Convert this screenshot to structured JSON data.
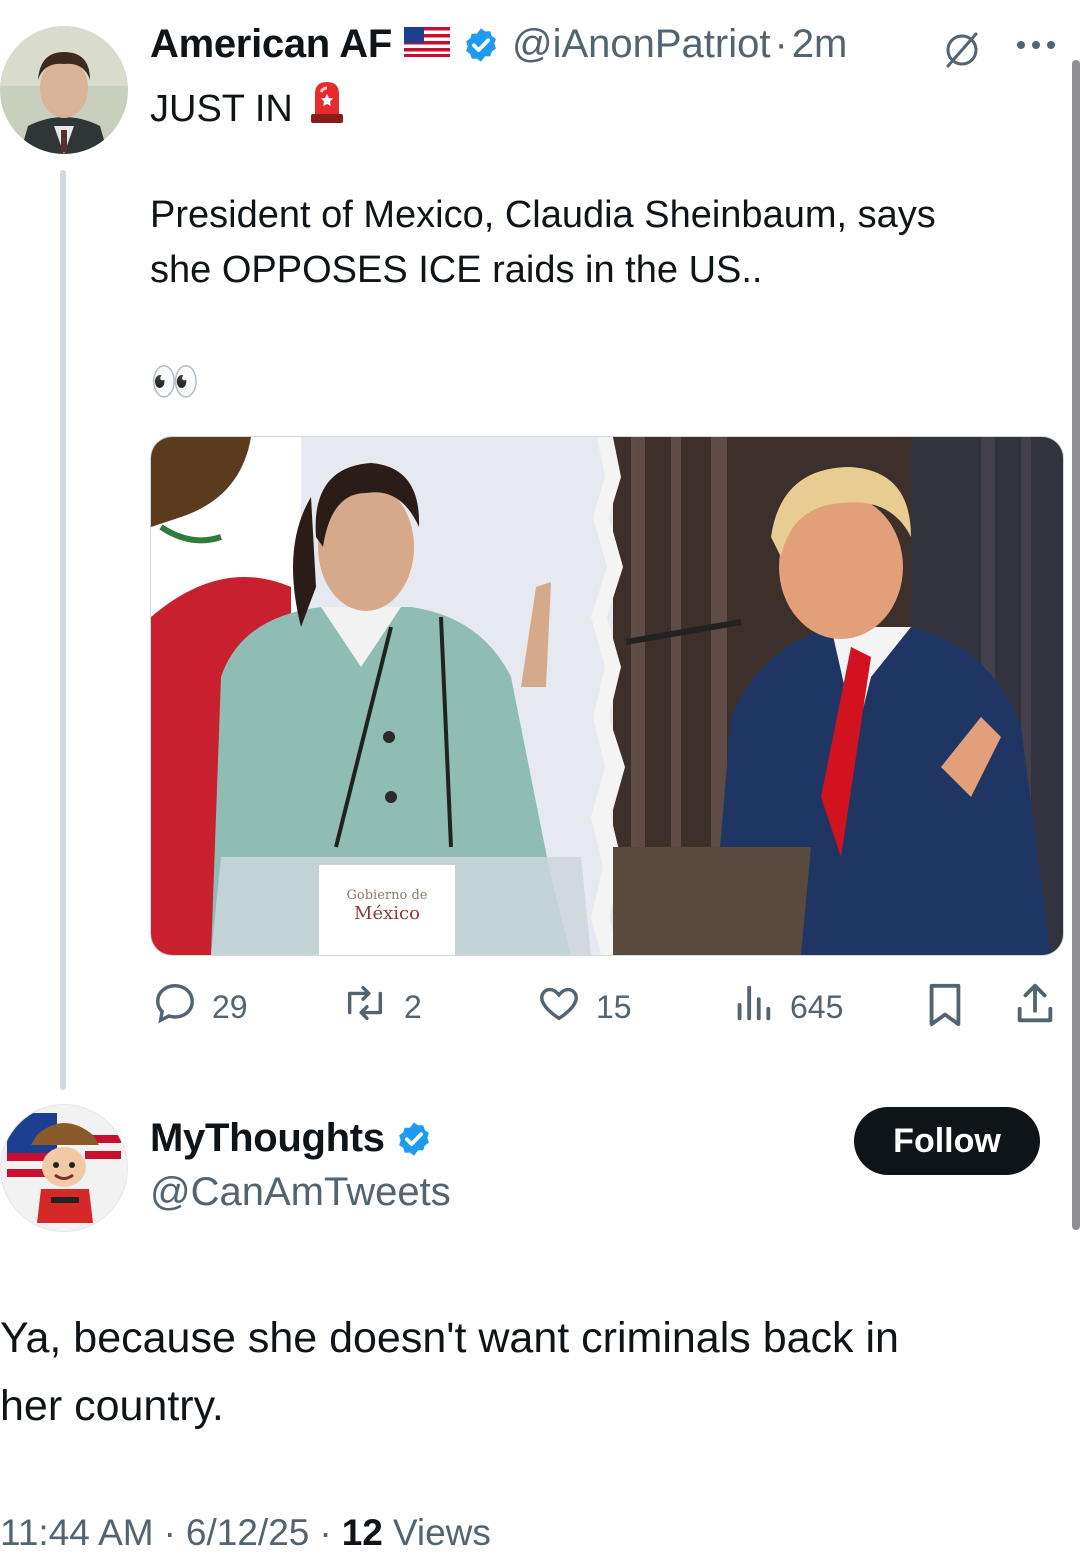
{
  "original_tweet": {
    "author_name": "American AF",
    "handle": "@iAnonPatriot",
    "separator": "·",
    "time": "2m",
    "line1": "JUST IN",
    "line2": "President of Mexico, Claudia Sheinbaum, says",
    "line3": "she OPPOSES ICE raids in the US..",
    "eyes_emoji": "👀",
    "image_text": {
      "podium_line1": "Gobierno de",
      "podium_line2": "México"
    },
    "actions": {
      "replies": "29",
      "reposts": "2",
      "likes": "15",
      "views": "645"
    }
  },
  "reply": {
    "author_name": "MyThoughts",
    "handle": "@CanAmTweets",
    "follow_label": "Follow",
    "text_line1": "Ya, because she doesn't want criminals back in",
    "text_line2": "her country.",
    "meta": {
      "time": "11:44 AM",
      "date": "6/12/25",
      "separator": "·",
      "views_count": "12",
      "views_label": "Views"
    }
  },
  "colors": {
    "verified_blue": "#1d9bf0",
    "text_primary": "#0f1419",
    "text_secondary": "#536471",
    "thread_line": "#cfd9de"
  }
}
